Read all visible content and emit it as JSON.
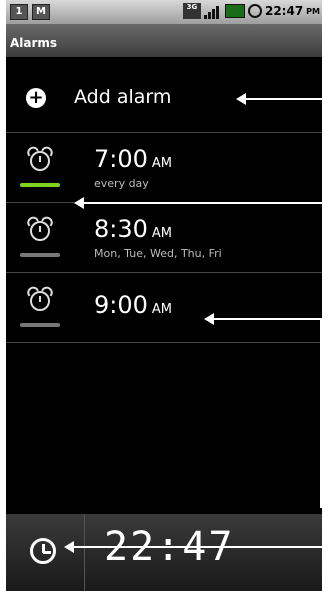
{
  "status_bar": {
    "sim_icon": "1",
    "gmail_icon": "M",
    "network": "3G",
    "time": "22:47",
    "ampm": "PM"
  },
  "title": "Alarms",
  "add_alarm_label": "Add alarm",
  "alarms": [
    {
      "time": "7:00",
      "ampm": "AM",
      "days": "every day",
      "enabled": true
    },
    {
      "time": "8:30",
      "ampm": "AM",
      "days": "Mon, Tue, Wed, Thu, Fri",
      "enabled": false
    },
    {
      "time": "9:00",
      "ampm": "AM",
      "days": "",
      "enabled": false
    }
  ],
  "clock_display": "22:47",
  "colors": {
    "enabled": "#7ed321",
    "disabled": "#777777"
  }
}
